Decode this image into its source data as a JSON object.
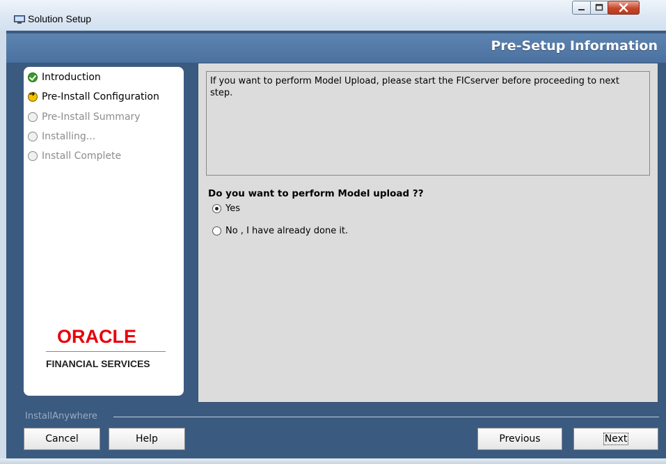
{
  "window": {
    "title": "Solution Setup",
    "controls": [
      "minimize-icon",
      "maximize-icon",
      "close-icon"
    ]
  },
  "header": {
    "title": "Pre-Setup Information"
  },
  "sidebar": {
    "steps": [
      {
        "label": "Introduction",
        "state": "done"
      },
      {
        "label": "Pre-Install Configuration",
        "state": "current"
      },
      {
        "label": "Pre-Install Summary",
        "state": "pending"
      },
      {
        "label": "Installing...",
        "state": "pending"
      },
      {
        "label": "Install Complete",
        "state": "pending"
      }
    ],
    "logo": {
      "brand": "ORACLE",
      "tagline": "FINANCIAL SERVICES"
    }
  },
  "main": {
    "message": "If you want to perform Model Upload, please start the FICserver before proceeding to next step.",
    "question": "Do you want to perform Model upload ??",
    "options": [
      {
        "label": "Yes",
        "selected": true
      },
      {
        "label": "No , I have already done it.",
        "selected": false
      }
    ]
  },
  "footer": {
    "group_label": "InstallAnywhere",
    "buttons": {
      "cancel": "Cancel",
      "help": "Help",
      "previous": "Previous",
      "next": "Next"
    }
  },
  "colors": {
    "frame": "#3b5a80",
    "header": "#5d84b0",
    "content_bg": "#dcdcdc",
    "brand_red": "#e8000b"
  }
}
